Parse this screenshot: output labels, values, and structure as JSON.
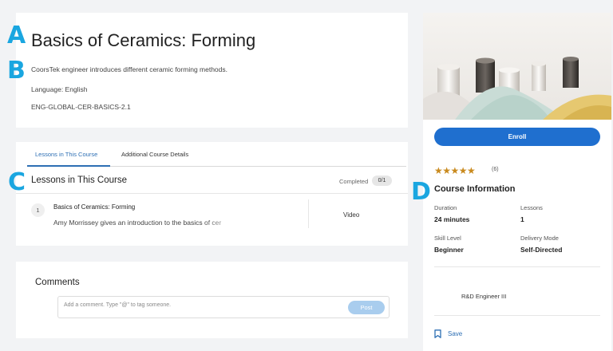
{
  "markers": {
    "a": "A",
    "b": "B",
    "c": "C",
    "d": "D"
  },
  "course": {
    "title": "Basics of Ceramics: Forming",
    "description": "CoorsTek engineer introduces different ceramic forming methods.",
    "language": "Language: English",
    "code": "ENG-GLOBAL-CER-BASICS-2.1"
  },
  "tabs": [
    {
      "label": "Lessons in This Course",
      "active": true
    },
    {
      "label": "Additional Course Details",
      "active": false
    }
  ],
  "lessons_section": {
    "heading": "Lessons in This Course",
    "completed_label": "Completed",
    "completed_value": "0/1",
    "lessons": [
      {
        "number": "1",
        "title": "Basics of Ceramics: Forming",
        "description": "Amy Morrissey gives an introduction to the basics of cer",
        "type": "Video"
      }
    ]
  },
  "comments": {
    "heading": "Comments",
    "placeholder": "Add a comment. Type \"@\" to tag someone.",
    "post_label": "Post"
  },
  "sidebar": {
    "hero_image": "ceramic-powders-and-parts-image",
    "enroll_label": "Enroll",
    "stars": "★★★★★",
    "rating_count": "(6)",
    "info_heading": "Course Information",
    "info": [
      {
        "label": "Duration",
        "value": "24 minutes"
      },
      {
        "label": "Lessons",
        "value": "1"
      },
      {
        "label": "Skill Level",
        "value": "Beginner"
      },
      {
        "label": "Delivery Mode",
        "value": "Self-Directed"
      }
    ],
    "role": "R&D Engineer III",
    "save_label": "Save",
    "save_icon": "bookmark-icon"
  },
  "colors": {
    "accent": "#1f6fcf",
    "link": "#2d6fb4",
    "marker": "#1aa6e0",
    "star": "#c98a1e"
  }
}
